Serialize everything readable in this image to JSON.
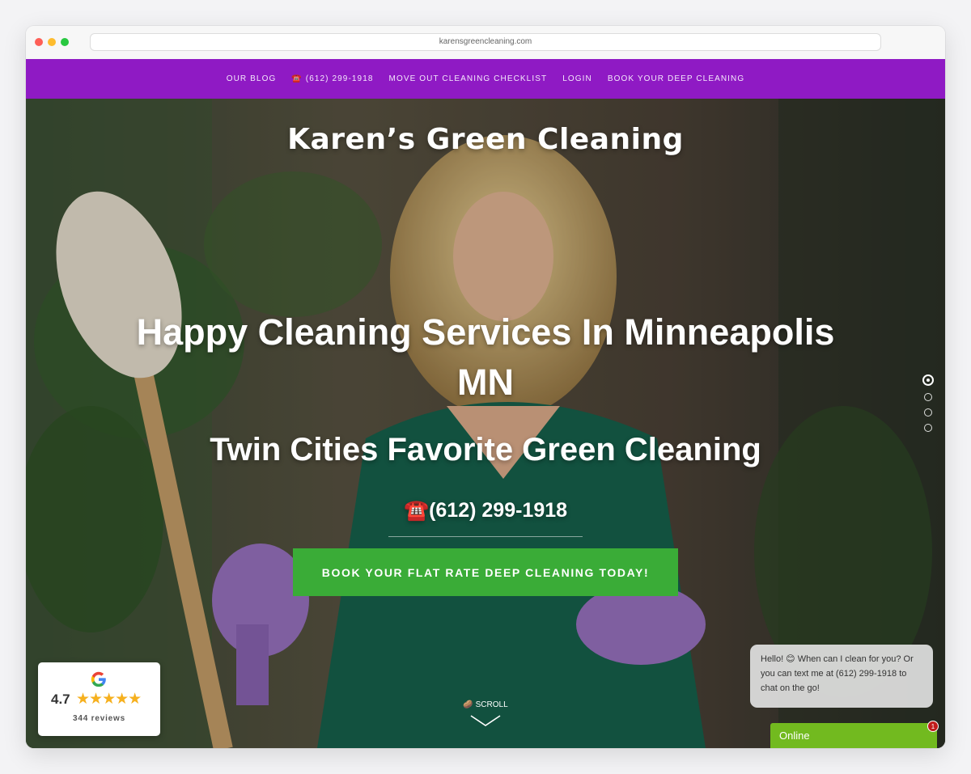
{
  "browser": {
    "url": "karensgreencleaning.com"
  },
  "nav": {
    "items": [
      {
        "label": "OUR BLOG"
      },
      {
        "label": "☎️ (612) 299-1918"
      },
      {
        "label": "MOVE OUT CLEANING CHECKLIST"
      },
      {
        "label": "LOGIN"
      },
      {
        "label": "BOOK YOUR DEEP CLEANING"
      }
    ]
  },
  "hero": {
    "site_title": "Karen’s Green Cleaning",
    "headline_line1": "Happy Cleaning Services In Minneapolis",
    "headline_line2": "MN",
    "subheadline": "Twin Cities Favorite Green Cleaning",
    "phone": "☎️(612) 299-1918",
    "cta_label": "BOOK YOUR FLAT RATE DEEP CLEANING TODAY!",
    "scroll_label": "SCROLL",
    "slider": {
      "count": 4,
      "active_index": 0
    }
  },
  "reviews_badge": {
    "rating": "4.7",
    "stars": "★★★★★",
    "count_label": "344 reviews"
  },
  "chat": {
    "message": "Hello! 😊 When can I clean for you? Or you can text me at (612) 299-1918 to chat on the go!",
    "status_label": "Online",
    "badge_count": "1"
  },
  "colors": {
    "nav_bg": "#8f1ac4",
    "cta_bg": "#3aac37",
    "chat_online_bg": "#72ba1f",
    "star": "#f6b01e"
  }
}
